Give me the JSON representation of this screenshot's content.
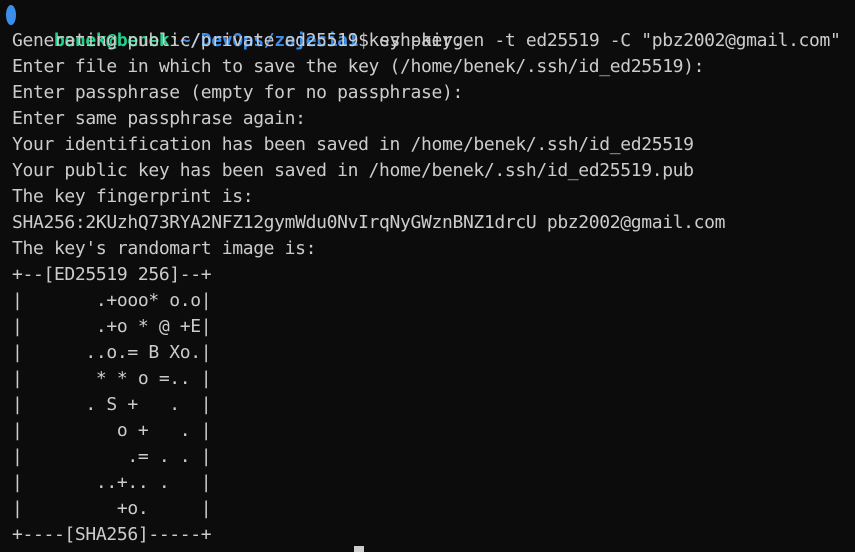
{
  "prompt": {
    "user_host": "benek@benek",
    "separator": ":",
    "path": "~/DevOps/zajecia1",
    "symbol": "$",
    "command": " ssh-keygen -t ed25519 -C \"pbz2002@gmail.com\""
  },
  "output_lines": [
    "Generating public/private ed25519 key pair.",
    "Enter file in which to save the key (/home/benek/.ssh/id_ed25519):",
    "Enter passphrase (empty for no passphrase):",
    "Enter same passphrase again:",
    "Your identification has been saved in /home/benek/.ssh/id_ed25519",
    "Your public key has been saved in /home/benek/.ssh/id_ed25519.pub",
    "The key fingerprint is:",
    "SHA256:2KUzhQ73RYA2NFZ12gymWdu0NvIrqNyGWznBNZ1drcU pbz2002@gmail.com",
    "The key's randomart image is:",
    "+--[ED25519 256]--+",
    "|       .+ooo* o.o|",
    "|       .+o * @ +E|",
    "|      ..o.= B Xo.|",
    "|       * * o =.. |",
    "|      . S +   .  |",
    "|         o +   . |",
    "|          .= . . |",
    "|       ..+.. .   |",
    "|         +o.     |",
    "+----[SHA256]-----+"
  ],
  "colors": {
    "background": "#0c0c0c",
    "foreground": "#cccccc",
    "user_host": "#23d18b",
    "path": "#3b8eea"
  }
}
